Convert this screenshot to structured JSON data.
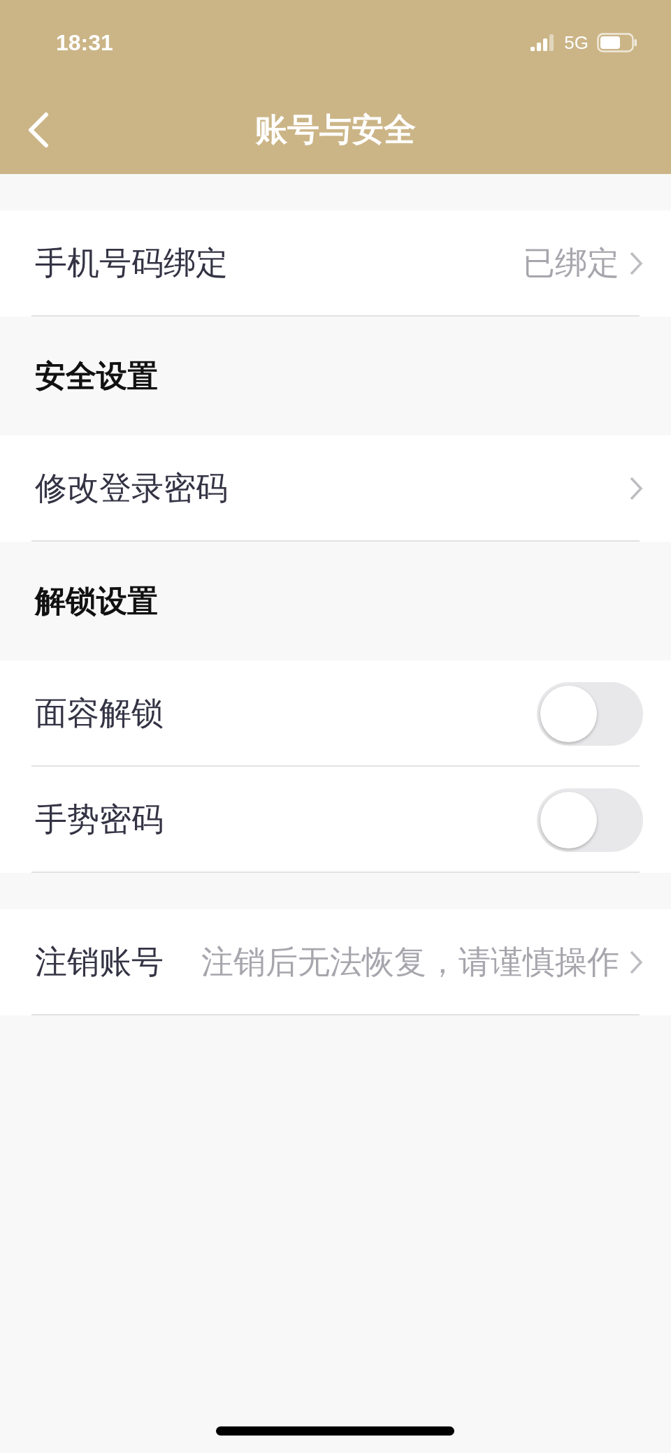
{
  "status_bar": {
    "time": "18:31",
    "network": "5G"
  },
  "nav": {
    "title": "账号与安全"
  },
  "sections": [
    {
      "rows": [
        {
          "kind": "link",
          "label": "手机号码绑定",
          "value": "已绑定"
        }
      ]
    },
    {
      "header": "安全设置",
      "rows": [
        {
          "kind": "link",
          "label": "修改登录密码"
        }
      ]
    },
    {
      "header": "解锁设置",
      "rows": [
        {
          "kind": "toggle",
          "label": "面容解锁",
          "on": false
        },
        {
          "kind": "toggle",
          "label": "手势密码",
          "on": false
        }
      ]
    },
    {
      "rows": [
        {
          "kind": "link",
          "label": "注销账号",
          "value": "注销后无法恢复，请谨慎操作"
        }
      ]
    }
  ]
}
